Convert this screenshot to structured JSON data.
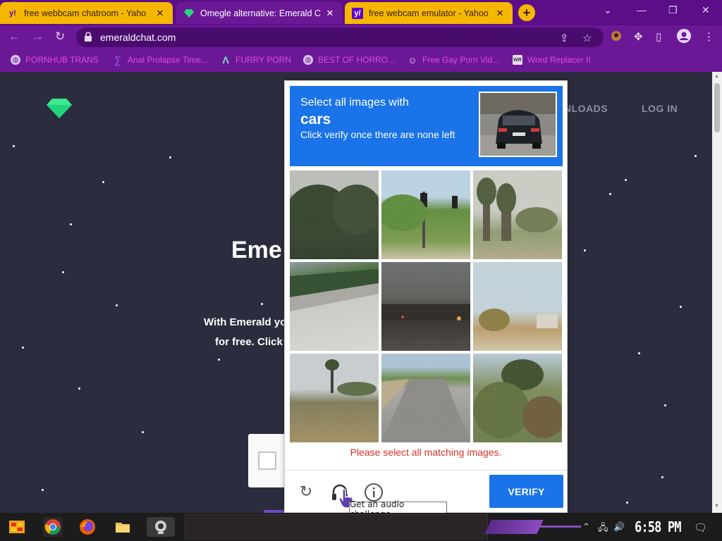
{
  "tabs": [
    {
      "title": "free webbcam chatroom - Yaho",
      "favicon": "yahoo-y"
    },
    {
      "title": "Omegle alternative: Emerald C",
      "favicon": "emerald-gem"
    },
    {
      "title": "free webcam emulator - Yahoo",
      "favicon": "yahoo-y"
    }
  ],
  "new_tab_label": "+",
  "window_controls": {
    "minimize": "—",
    "restore": "❐",
    "close": "✕"
  },
  "omnibox": {
    "url": "emeraldchat.com"
  },
  "bookmarks": [
    {
      "label": "PORNHUB TRANS",
      "icon": "globe-icon"
    },
    {
      "label": "Anal Prolapse Time...",
      "icon": "bracket-icon"
    },
    {
      "label": "FURRY PORN",
      "icon": "a-logo-icon"
    },
    {
      "label": "BEST OF HORRO...",
      "icon": "globe-icon"
    },
    {
      "label": "Free Gay Porn Vid...",
      "icon": "face-icon"
    },
    {
      "label": "Word Replacer II",
      "icon": "wr-icon"
    }
  ],
  "page": {
    "nav": [
      "NLOADS",
      "LOG IN"
    ],
    "hero_title": "Eme",
    "hero_line1": "With Emerald yo",
    "hero_line2": "for free. Click"
  },
  "recaptcha": {
    "instruction_line1": "Select all images with",
    "target": "cars",
    "instruction_line3": "Click verify once there are none left",
    "error": "Please select all matching images.",
    "verify_label": "VERIFY",
    "icons": [
      "reload-icon",
      "headphones-icon",
      "info-icon"
    ]
  },
  "tooltip": "Get an audio challenge",
  "taskbar": {
    "clock": "6:58 PM",
    "icons": [
      "start-icon",
      "chrome-icon",
      "firefox-icon",
      "folder-icon",
      "webcam-icon"
    ]
  },
  "colors": {
    "tab_active": "#6b1897",
    "tab_inactive": "#f6b700",
    "bookmark_text": "#e04cd8",
    "recaptcha_blue": "#1a73e8",
    "error_red": "#d93025",
    "page_bg": "#2b2c3d"
  }
}
